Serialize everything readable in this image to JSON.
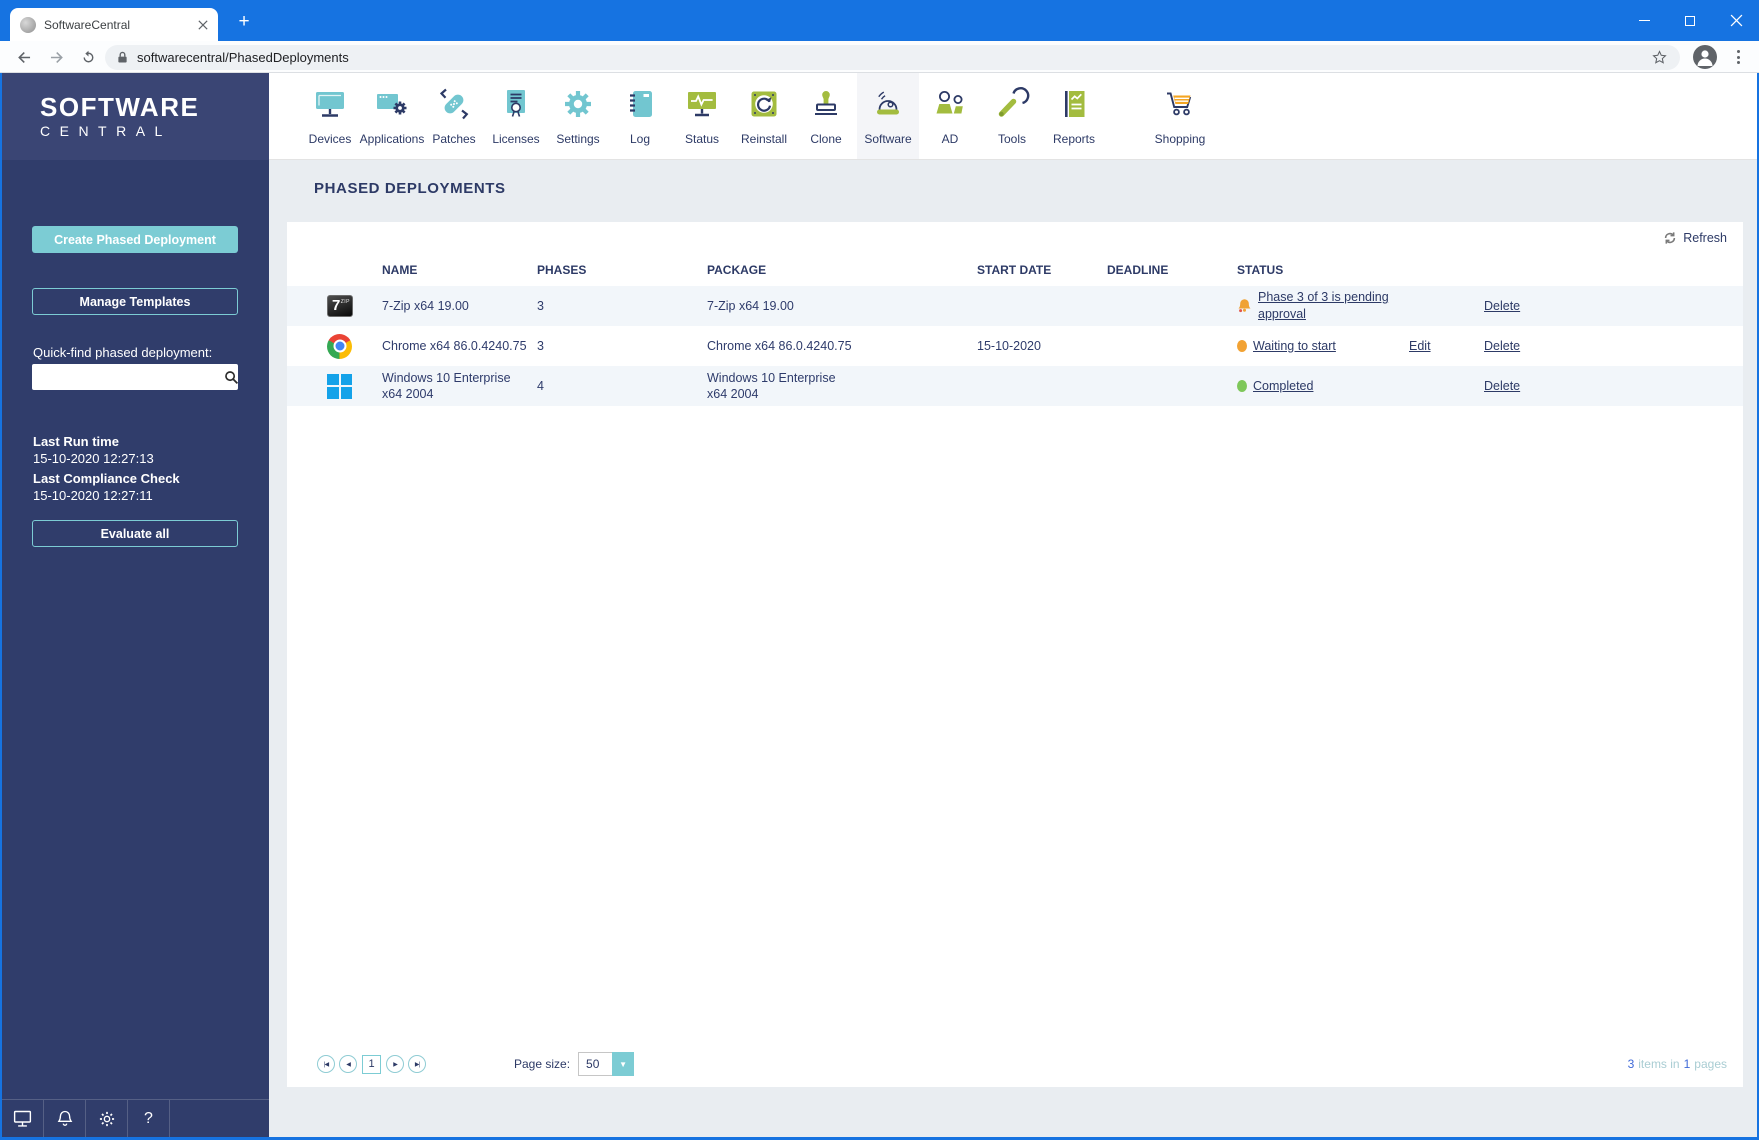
{
  "browser": {
    "tab_title": "SoftwareCentral",
    "url": "softwarecentral/PhasedDeployments"
  },
  "logo": {
    "line1": "SOFTWARE",
    "line2": "CENTRAL"
  },
  "sidebar": {
    "create_button": "Create Phased Deployment",
    "manage_button": "Manage Templates",
    "quickfind_label": "Quick-find phased deployment:",
    "search_value": "",
    "last_run_label": "Last Run time",
    "last_run_value": "15-10-2020 12:27:13",
    "last_compliance_label": "Last Compliance Check",
    "last_compliance_value": "15-10-2020 12:27:11",
    "evaluate_button": "Evaluate all"
  },
  "nav": {
    "items": [
      {
        "label": "Devices",
        "selected": false
      },
      {
        "label": "Applications",
        "selected": false
      },
      {
        "label": "Patches",
        "selected": false
      },
      {
        "label": "Licenses",
        "selected": false
      },
      {
        "label": "Settings",
        "selected": false
      },
      {
        "label": "Log",
        "selected": false
      },
      {
        "label": "Status",
        "selected": false
      },
      {
        "label": "Reinstall",
        "selected": false
      },
      {
        "label": "Clone",
        "selected": false
      },
      {
        "label": "Software",
        "selected": true
      },
      {
        "label": "AD",
        "selected": false
      },
      {
        "label": "Tools",
        "selected": false
      },
      {
        "label": "Reports",
        "selected": false
      },
      {
        "label": "Shopping",
        "selected": false
      }
    ]
  },
  "main": {
    "title": "PHASED DEPLOYMENTS",
    "refresh_label": "Refresh",
    "table": {
      "headers": [
        "NAME",
        "PHASES",
        "PACKAGE",
        "START DATE",
        "DEADLINE",
        "STATUS"
      ],
      "actions": {
        "edit": "Edit",
        "delete": "Delete"
      },
      "rows": [
        {
          "icon": "7zip-icon",
          "name": "7-Zip x64 19.00",
          "phases": "3",
          "package": "7-Zip x64 19.00",
          "start_date": "",
          "deadline": "",
          "status": "Phase 3 of 3 is pending approval",
          "status_icon": "pending-bell-icon"
        },
        {
          "icon": "chrome-icon",
          "name": "Chrome x64 86.0.4240.75",
          "phases": "3",
          "package": "Chrome x64 86.0.4240.75",
          "start_date": "15-10-2020",
          "deadline": "",
          "status": "Waiting to start",
          "status_icon": "orange-dot-icon"
        },
        {
          "icon": "windows-icon",
          "name": "Windows 10 Enterprise x64 2004",
          "phases": "4",
          "package": "Windows 10 Enterprise x64 2004",
          "start_date": "",
          "deadline": "",
          "status": "Completed",
          "status_icon": "green-dot-icon"
        }
      ]
    },
    "pagination": {
      "first": "|◀",
      "prev": "◀",
      "current_page": "1",
      "next": "▶",
      "last": "▶|",
      "page_size_label": "Page size:",
      "page_size": "50",
      "summary": {
        "count": "3",
        "items_in": "items in",
        "pages_count": "1",
        "pages_word": "pages"
      }
    }
  },
  "colors": {
    "theme_blue": "#1673e1",
    "navy": "#2d3a66",
    "sidebar_navy": "#303d6b",
    "logo_band_navy": "#3a4574",
    "accent_teal_icon": "#72c6d0",
    "accent_green_icon": "#a3bc3f",
    "button_teal": "#7cccd4",
    "status_orange": "#f2a233",
    "status_green": "#7ec75a",
    "cart_orange": "#f5a623",
    "main_bg": "#e9edf1",
    "row_alt_bg": "#f2f6fa"
  }
}
